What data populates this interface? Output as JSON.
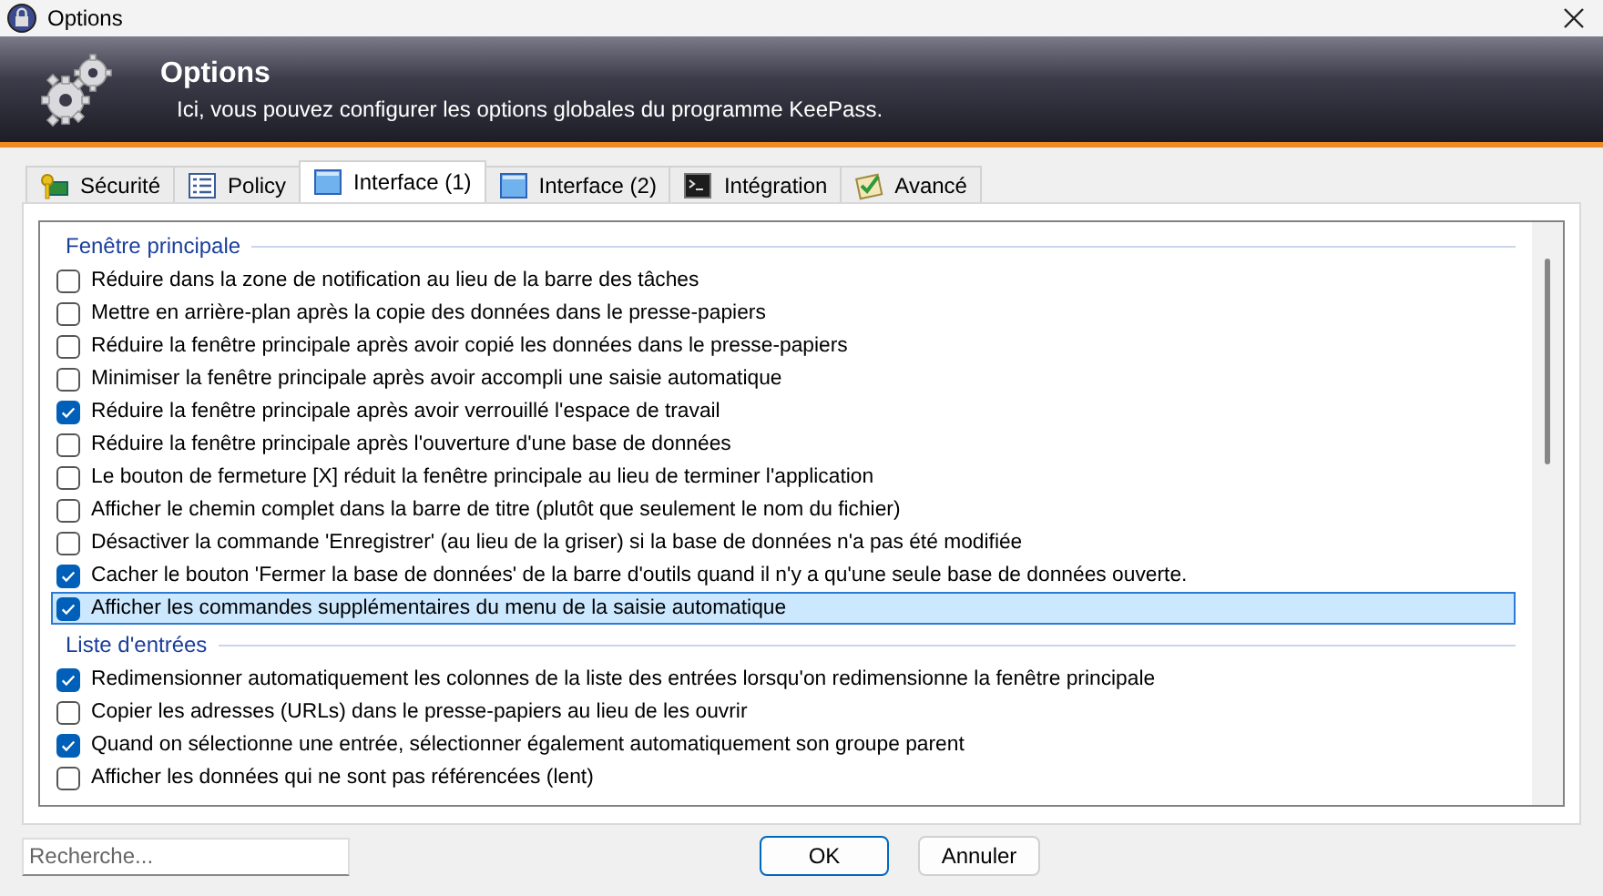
{
  "window": {
    "title": "Options"
  },
  "banner": {
    "title": "Options",
    "subtitle": "Ici, vous pouvez configurer les options globales du programme KeePass."
  },
  "tabs": [
    {
      "label": "Sécurité",
      "kind": "key",
      "selected": false
    },
    {
      "label": "Policy",
      "kind": "list",
      "selected": false
    },
    {
      "label": "Interface (1)",
      "kind": "window",
      "selected": true
    },
    {
      "label": "Interface (2)",
      "kind": "window",
      "selected": false
    },
    {
      "label": "Intégration",
      "kind": "console",
      "selected": false
    },
    {
      "label": "Avancé",
      "kind": "checklist",
      "selected": false
    }
  ],
  "groups": [
    {
      "title": "Fenêtre principale",
      "options": [
        {
          "label": "Réduire dans la zone de notification au lieu de la barre des tâches",
          "checked": false,
          "selected": false
        },
        {
          "label": "Mettre en arrière-plan après la copie des données dans le presse-papiers",
          "checked": false,
          "selected": false
        },
        {
          "label": "Réduire la fenêtre principale après avoir copié les données dans le presse-papiers",
          "checked": false,
          "selected": false
        },
        {
          "label": "Minimiser la fenêtre principale après avoir accompli une saisie automatique",
          "checked": false,
          "selected": false
        },
        {
          "label": "Réduire la fenêtre principale après avoir verrouillé l'espace de travail",
          "checked": true,
          "selected": false
        },
        {
          "label": "Réduire la fenêtre principale après l'ouverture d'une base de données",
          "checked": false,
          "selected": false
        },
        {
          "label": "Le bouton de fermeture [X] réduit la fenêtre principale au lieu de terminer l'application",
          "checked": false,
          "selected": false
        },
        {
          "label": "Afficher le chemin complet dans la barre de titre (plutôt que seulement le nom du fichier)",
          "checked": false,
          "selected": false
        },
        {
          "label": "Désactiver la commande 'Enregistrer' (au lieu de la griser) si la base de données n'a pas été modifiée",
          "checked": false,
          "selected": false
        },
        {
          "label": "Cacher le bouton 'Fermer la base de données' de la barre d'outils quand il n'y a qu'une seule base de données ouverte.",
          "checked": true,
          "selected": false
        },
        {
          "label": "Afficher les commandes supplémentaires du menu de la saisie automatique",
          "checked": true,
          "selected": true
        }
      ]
    },
    {
      "title": "Liste d'entrées",
      "options": [
        {
          "label": "Redimensionner automatiquement les colonnes de la liste des entrées lorsqu'on redimensionne la fenêtre principale",
          "checked": true,
          "selected": false
        },
        {
          "label": "Copier les adresses (URLs) dans le presse-papiers au lieu de les ouvrir",
          "checked": false,
          "selected": false
        },
        {
          "label": "Quand on sélectionne une entrée, sélectionner également automatiquement son groupe parent",
          "checked": true,
          "selected": false
        },
        {
          "label": "Afficher les données qui ne sont pas référencées (lent)",
          "checked": false,
          "selected": false
        }
      ]
    }
  ],
  "search": {
    "placeholder": "Recherche..."
  },
  "buttons": [
    "OK",
    "Annuler"
  ]
}
